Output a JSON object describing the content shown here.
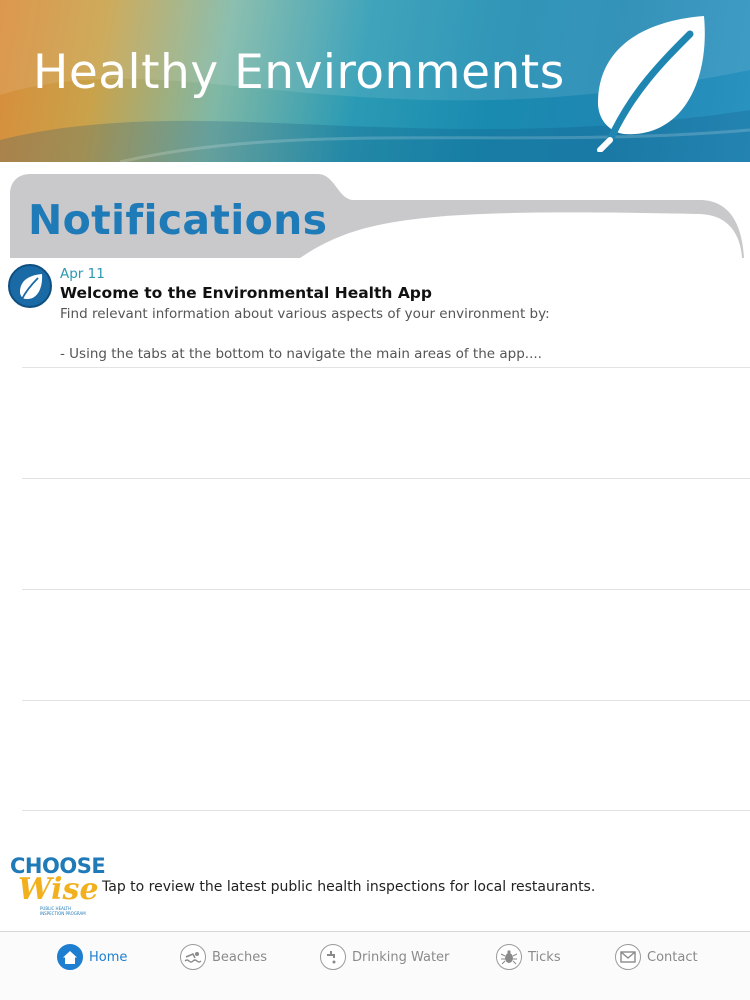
{
  "header": {
    "title": "Healthy Environments",
    "logo_icon": "leaf-icon"
  },
  "section": {
    "title": "Notifications"
  },
  "notifications": [
    {
      "icon": "leaf-icon",
      "date": "Apr 11",
      "title": "Welcome to the Environmental Health App",
      "body": "Find relevant information about various aspects of your environment by:\n\n- Using the tabs at the bottom to navigate the main areas of the app...."
    }
  ],
  "banner": {
    "logo_line1": "CHOOSE",
    "logo_line2": "Wise",
    "logo_sub": "PUBLIC HEALTH INSPECTION PROGRAM",
    "text": "Tap to review the latest public health inspections for local restaurants."
  },
  "tabs": [
    {
      "label": "Home",
      "icon": "home-icon",
      "active": true
    },
    {
      "label": "Beaches",
      "icon": "swimmer-icon",
      "active": false
    },
    {
      "label": "Drinking Water",
      "icon": "faucet-icon",
      "active": false
    },
    {
      "label": "Ticks",
      "icon": "tick-icon",
      "active": false
    },
    {
      "label": "Contact",
      "icon": "envelope-icon",
      "active": false
    }
  ],
  "colors": {
    "brand_blue": "#1f7ab8",
    "accent_teal": "#2a9ab0",
    "active_tab": "#1e7fd0",
    "wise_yellow": "#f2b01e"
  }
}
